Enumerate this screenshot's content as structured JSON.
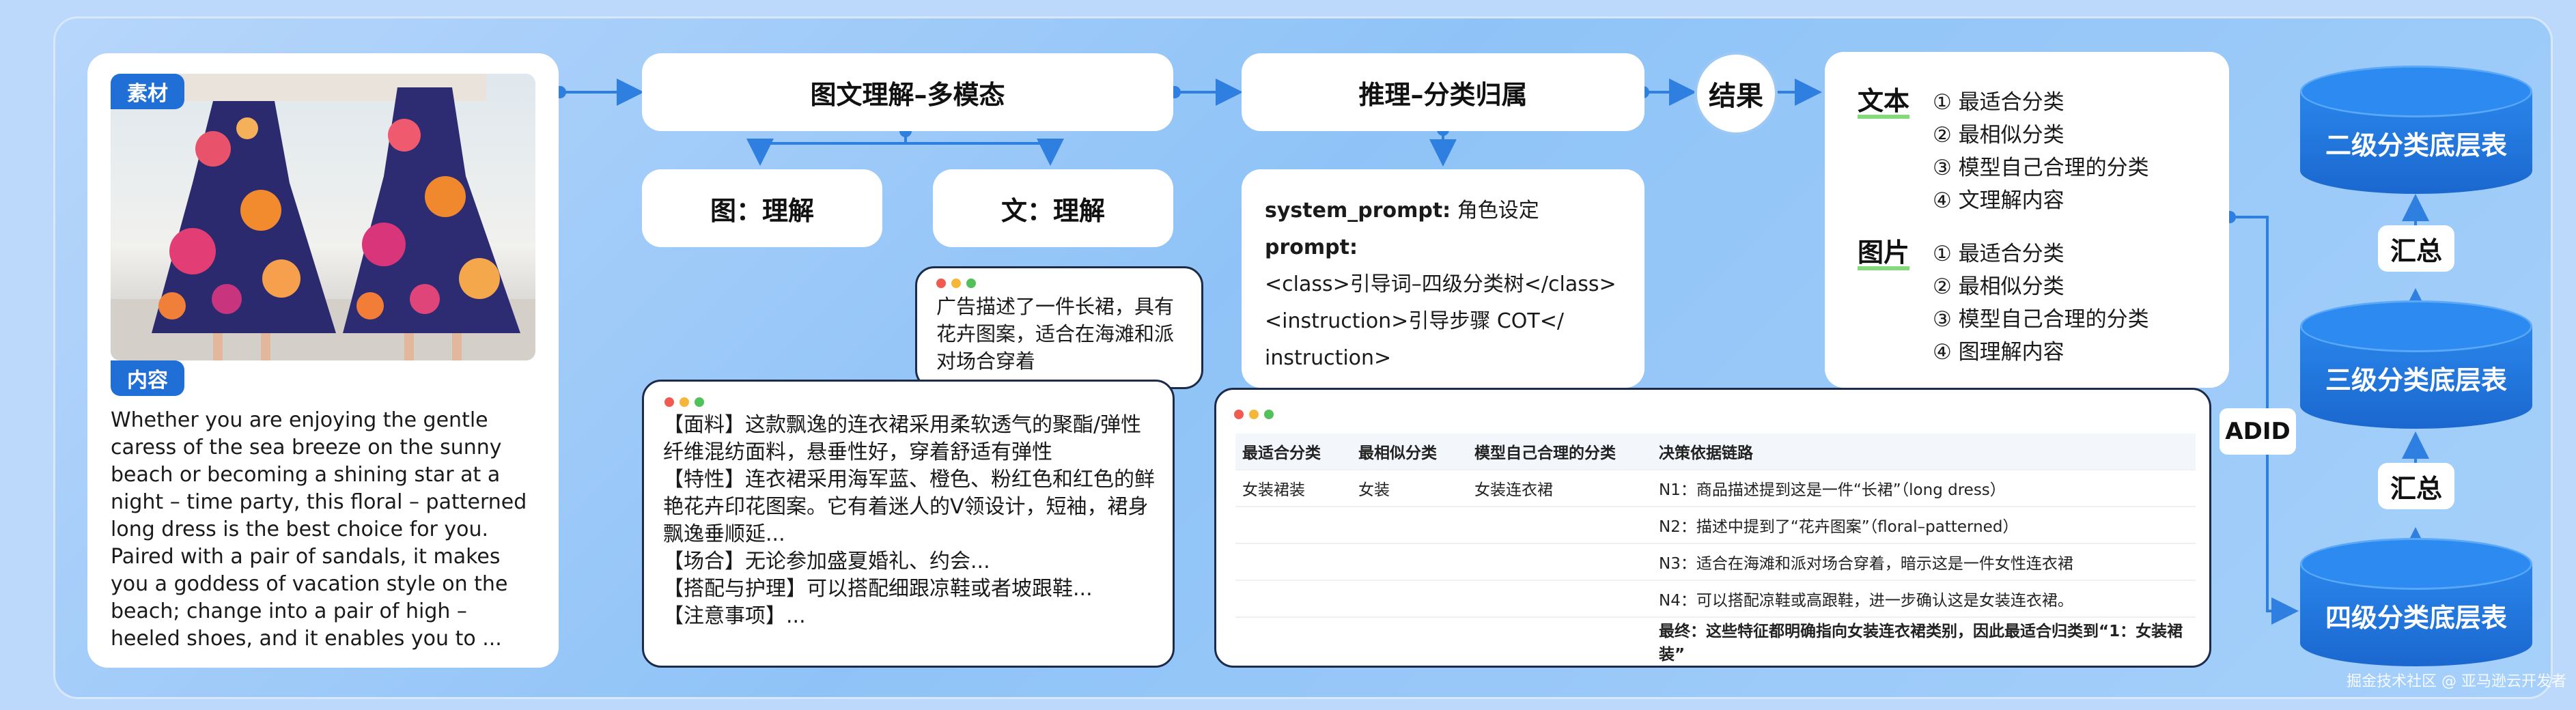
{
  "material": {
    "tag_top": "素材",
    "tag_content": "内容",
    "content_text": "Whether you are enjoying the gentle caress of the sea breeze on the sunny beach or becoming a shining star at a night – time party, this floral – patterned long dress is the best choice for you. Paired with a pair of sandals, it makes you a goddess of vacation style on the beach; change into a pair of high – heeled shoes, and it enables you to ..."
  },
  "multimodal": {
    "title": "图文理解–多模态",
    "image_box": "图：理解",
    "text_box": "文：理解",
    "text_bubble": "广告描述了一件长裙，具有花卉图案，适合在海滩和派对场合穿着",
    "image_bubble_lines": [
      "【面料】这款飘逸的连衣裙采用柔软透气的聚酯/弹性纤维混纺面料，悬垂性好，穿着舒适有弹性",
      "【特性】连衣裙采用海军蓝、橙色、粉红色和红色的鲜艳花卉印花图案。它有着迷人的V领设计，短袖，裙身飘逸垂顺延...",
      "【场合】无论参加盛夏婚礼、约会...",
      "【搭配与护理】可以搭配细跟凉鞋或者坡跟鞋...",
      "【注意事项】..."
    ]
  },
  "reasoning": {
    "title": "推理–分类归属",
    "prompt_lines": [
      {
        "label": "system_prompt:",
        "value": " 角色设定"
      },
      {
        "label": "prompt:",
        "value": ""
      },
      {
        "label": "",
        "value": "<class>引导词–四级分类树</class>"
      },
      {
        "label": "",
        "value": " <instruction>引导步骤 COT</"
      },
      {
        "label": "",
        "value": "instruction>"
      }
    ]
  },
  "result": {
    "circle": "结果",
    "text_label": "文本",
    "text_items": [
      "① 最适合分类",
      "② 最相似分类",
      "③ 模型自己合理的分类",
      "④ 文理解内容"
    ],
    "image_label": "图片",
    "image_items": [
      "① 最适合分类",
      "② 最相似分类",
      "③ 模型自己合理的分类",
      "④ 图理解内容"
    ]
  },
  "decision_table": {
    "headers": [
      "最适合分类",
      "最相似分类",
      "模型自己合理的分类",
      "决策依据链路"
    ],
    "cells": [
      "女装裙装",
      "女装",
      "女装连衣裙"
    ],
    "chain": [
      "N1：商品描述提到这是一件“长裙”（long dress）",
      "N2：描述中提到了“花卉图案”（floral–patterned）",
      "N3：适合在海滩和派对场合穿着，暗示这是一件女性连衣裙",
      "N4：可以搭配凉鞋或高跟鞋，进一步确认这是女装连衣裙。",
      "最终：这些特征都明确指向女装连衣裙类别，因此最适合归类到“1：女装裙装”"
    ]
  },
  "tables": {
    "level2": "二级分类底层表",
    "level3": "三级分类底层表",
    "level4": "四级分类底层表",
    "summary": "汇总",
    "adid": "ADID"
  },
  "watermark": "掘金技术社区 @ 亚马逊云开发者",
  "colors": {
    "accent": "#1f6fd6",
    "connector": "#2f7fe0",
    "cylinder": "#1a67cf"
  }
}
